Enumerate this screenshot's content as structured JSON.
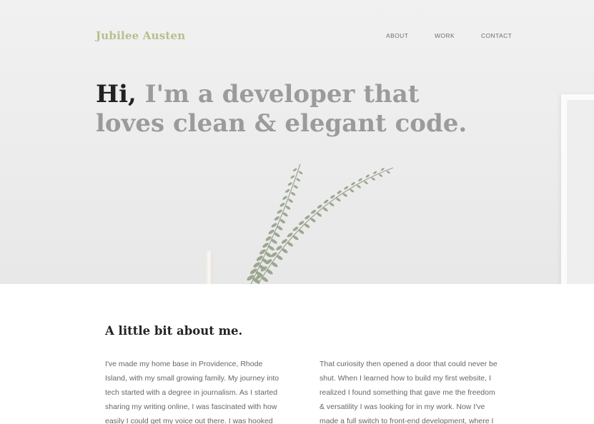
{
  "header": {
    "logo": "Jubilee Austen",
    "nav": [
      {
        "label": "ABOUT"
      },
      {
        "label": "WORK"
      },
      {
        "label": "CONTACT"
      }
    ]
  },
  "hero": {
    "greeting": "Hi,",
    "headline_rest": " I'm a developer that loves clean & elegant code."
  },
  "about": {
    "title": "A little bit about me.",
    "left_text": "I've made my home base in Providence, Rhode Island, with my small growing family. My journey into tech started with a degree in journalism. As I started sharing my writing online, I was fascinated with how easily I could get my voice out there. I was hooked and wanted",
    "right_text": "That curiosity then opened a door that could never be shut. When I learned how to build my first website, I realized I found something that gave me the freedom & versatility I was looking for in my work. Now I've made a full switch to front-end development, where I can use my"
  }
}
